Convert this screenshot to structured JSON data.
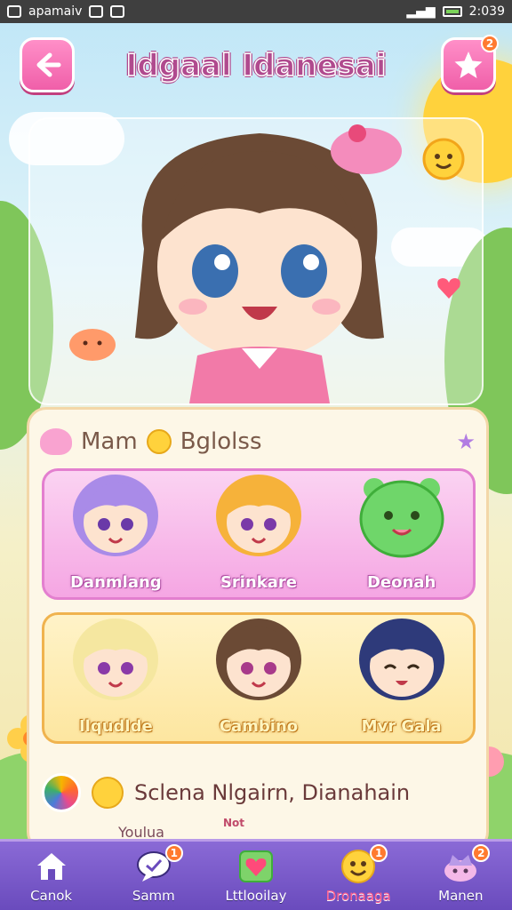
{
  "status_bar": {
    "left_text": "apamaiv",
    "time": "2:039"
  },
  "header": {
    "title": "Idgaal Idanesai",
    "back_icon": "arrow-left-icon",
    "fav_icon": "star-icon",
    "fav_badge": "2"
  },
  "section": {
    "label_a": "Mam",
    "label_b": "Bglolss"
  },
  "characters_row1": [
    {
      "name": "Danmlang",
      "hair": "#a98be8"
    },
    {
      "name": "Srinkare",
      "hair": "#f6b23a"
    },
    {
      "name": "Deonah",
      "hair": "#6fd66a"
    }
  ],
  "characters_row2": [
    {
      "name": "Ilqudlde",
      "hair": "#f5e7a0"
    },
    {
      "name": "Cambino",
      "hair": "#6b4a35"
    },
    {
      "name": "Mvr Gala",
      "hair": "#2e3a7a"
    }
  ],
  "featured": {
    "title": "Sclena Nlgairn, Dianahain",
    "sub_a": "Youlua",
    "sub_b": "Not"
  },
  "nav": [
    {
      "label": "Canok",
      "icon": "home-icon",
      "badge": ""
    },
    {
      "label": "Samm",
      "icon": "chat-icon",
      "badge": "1"
    },
    {
      "label": "Lttlooilay",
      "icon": "heart-icon",
      "badge": ""
    },
    {
      "label": "Dronaaga",
      "icon": "smiley-icon",
      "badge": "1",
      "active": true
    },
    {
      "label": "Manen",
      "icon": "crown-icon",
      "badge": "2"
    }
  ],
  "colors": {
    "accent_pink": "#f05fa9",
    "nav_purple": "#6a4bbd",
    "active_label": "#ff5a8a"
  }
}
